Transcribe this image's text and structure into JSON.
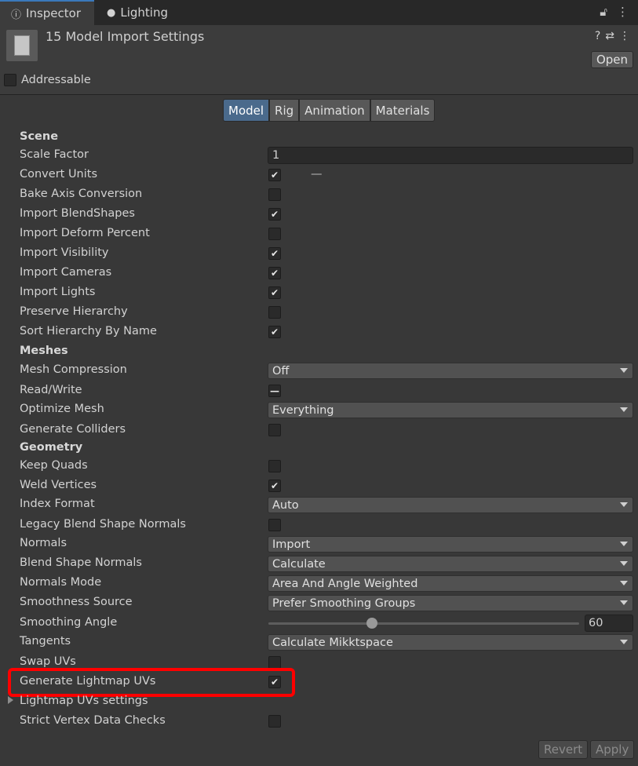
{
  "tabs": {
    "inspector": "Inspector",
    "lighting": "Lighting"
  },
  "header": {
    "title": "15 Model Import Settings",
    "open": "Open",
    "addressable": "Addressable"
  },
  "subtabs": [
    "Model",
    "Rig",
    "Animation",
    "Materials"
  ],
  "sections": {
    "scene": "Scene",
    "meshes": "Meshes",
    "geometry": "Geometry"
  },
  "rows": {
    "scale_factor": {
      "label": "Scale Factor",
      "value": "1"
    },
    "convert_units": {
      "label": "Convert Units",
      "checked": true,
      "dash": "—"
    },
    "bake_axis": {
      "label": "Bake Axis Conversion",
      "checked": false
    },
    "import_blendshapes": {
      "label": "Import BlendShapes",
      "checked": true
    },
    "import_deform": {
      "label": "Import Deform Percent",
      "checked": false
    },
    "import_visibility": {
      "label": "Import Visibility",
      "checked": true
    },
    "import_cameras": {
      "label": "Import Cameras",
      "checked": true
    },
    "import_lights": {
      "label": "Import Lights",
      "checked": true
    },
    "preserve_hierarchy": {
      "label": "Preserve Hierarchy",
      "checked": false
    },
    "sort_hierarchy": {
      "label": "Sort Hierarchy By Name",
      "checked": true
    },
    "mesh_compression": {
      "label": "Mesh Compression",
      "value": "Off"
    },
    "read_write": {
      "label": "Read/Write",
      "mixed": "—"
    },
    "optimize_mesh": {
      "label": "Optimize Mesh",
      "value": "Everything"
    },
    "generate_colliders": {
      "label": "Generate Colliders",
      "checked": false
    },
    "keep_quads": {
      "label": "Keep Quads",
      "checked": false
    },
    "weld_vertices": {
      "label": "Weld Vertices",
      "checked": true
    },
    "index_format": {
      "label": "Index Format",
      "value": "Auto"
    },
    "legacy_blend": {
      "label": "Legacy Blend Shape Normals",
      "checked": false
    },
    "normals": {
      "label": "Normals",
      "value": "Import"
    },
    "blend_shape_normals": {
      "label": "Blend Shape Normals",
      "value": "Calculate"
    },
    "normals_mode": {
      "label": "Normals Mode",
      "value": "Area And Angle Weighted"
    },
    "smoothness_source": {
      "label": "Smoothness Source",
      "value": "Prefer Smoothing Groups"
    },
    "smoothing_angle": {
      "label": "Smoothing Angle",
      "value": "60",
      "fraction": 0.333
    },
    "tangents": {
      "label": "Tangents",
      "value": "Calculate Mikktspace"
    },
    "swap_uvs": {
      "label": "Swap UVs",
      "checked": false
    },
    "generate_lightmap": {
      "label": "Generate Lightmap UVs",
      "checked": true
    },
    "lightmap_settings": {
      "label": "Lightmap UVs settings"
    },
    "strict_vertex": {
      "label": "Strict Vertex Data Checks",
      "checked": false
    }
  },
  "footer": {
    "revert": "Revert",
    "apply": "Apply"
  },
  "icons": {
    "info": "info-icon",
    "lightbulb": "lightbulb-icon",
    "lock": "lock-icon",
    "kebab": "kebab-menu-icon",
    "help": "help-icon",
    "preset": "preset-icon"
  },
  "colors": {
    "highlight": "#ff0000",
    "selected_tab": "#4a6a8c"
  }
}
